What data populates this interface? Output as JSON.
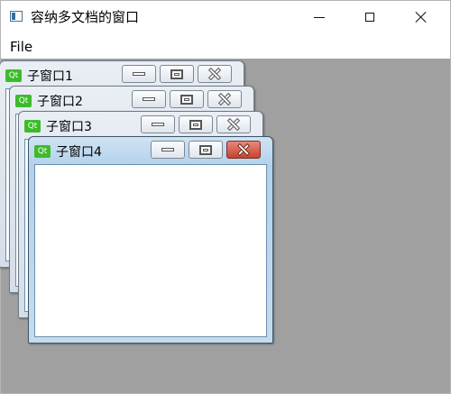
{
  "window": {
    "title": "容纳多文档的窗口"
  },
  "menu": {
    "file": "File"
  },
  "subwindows": [
    {
      "title": "子窗口1",
      "icon": "Qt"
    },
    {
      "title": "子窗口2",
      "icon": "Qt"
    },
    {
      "title": "子窗口3",
      "icon": "Qt"
    },
    {
      "title": "子窗口4",
      "icon": "Qt"
    }
  ]
}
